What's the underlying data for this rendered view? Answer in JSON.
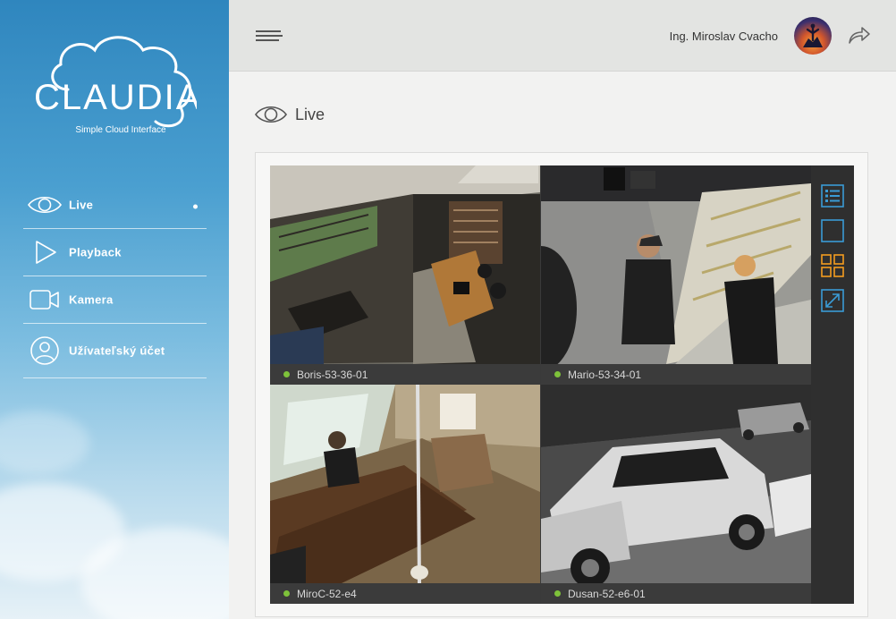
{
  "brand": {
    "name": "CLAUDIA",
    "tagline": "Simple Cloud Interface"
  },
  "sidebar": {
    "items": [
      {
        "label": "Live",
        "icon": "eye-icon",
        "active": true
      },
      {
        "label": "Playback",
        "icon": "play-icon",
        "active": false
      },
      {
        "label": "Kamera",
        "icon": "camera-icon",
        "active": false
      },
      {
        "label": "Užívateľský účet",
        "icon": "user-icon",
        "active": false
      }
    ]
  },
  "header": {
    "username": "Ing. Miroslav Cvacho",
    "menu_icon": "hamburger-icon",
    "logout_icon": "share-arrow-icon"
  },
  "page": {
    "title": "Live"
  },
  "cameras": [
    {
      "name": "Boris-53-36-01",
      "status": "online"
    },
    {
      "name": "Mario-53-34-01",
      "status": "online"
    },
    {
      "name": "MiroC-52-e4",
      "status": "online"
    },
    {
      "name": "Dusan-52-e6-01",
      "status": "online"
    }
  ],
  "toolbar": {
    "tools": [
      "list-view-icon",
      "single-view-icon",
      "grid-view-icon",
      "fullscreen-icon"
    ]
  },
  "colors": {
    "accent_orange": "#f39c1f",
    "accent_blue": "#3a9bd5",
    "status_online": "#7ec23a"
  }
}
